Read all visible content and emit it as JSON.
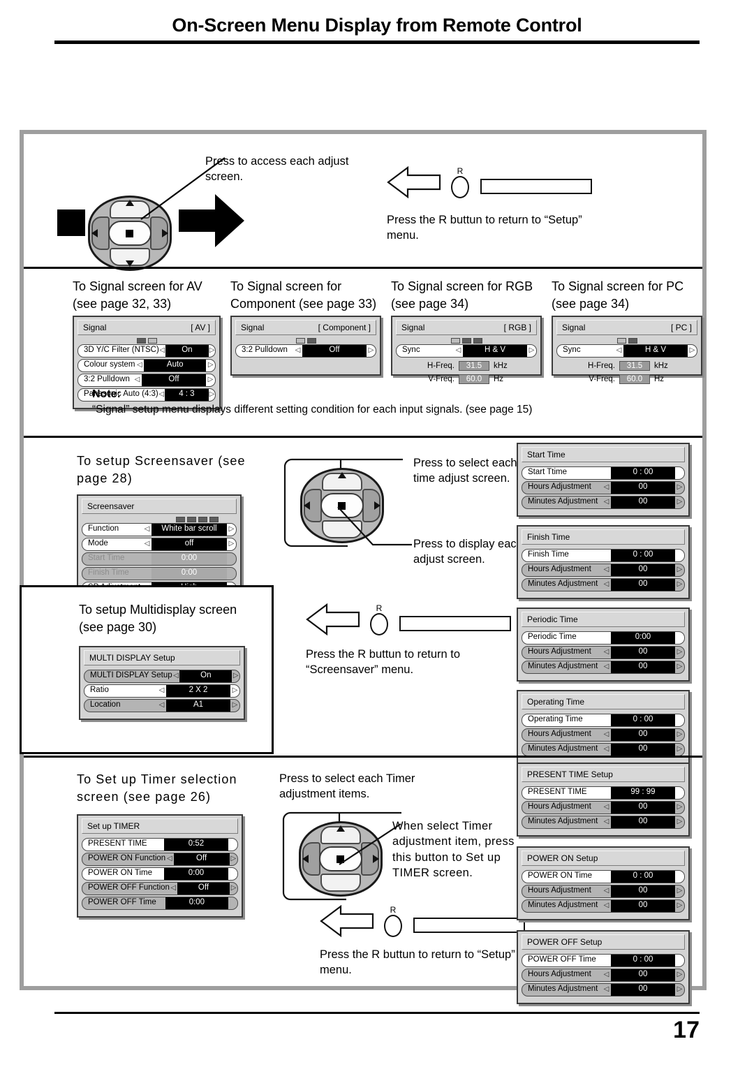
{
  "header": {
    "title": "On-Screen Menu Display from Remote Control"
  },
  "footer": {
    "page_number": "17"
  },
  "section_top": {
    "callout_access": "Press to access each adjust screen.",
    "r_label": "R",
    "return_text": "Press the R buttun to return to “Setup” menu."
  },
  "signal_section": {
    "columns": [
      {
        "heading": "To Signal screen for AV (see page 32, 33)",
        "panel": {
          "title_left": "Signal",
          "title_right": "[ AV ]",
          "dots": [
            true,
            false
          ],
          "rows": [
            {
              "label": "3D Y/C Filter  (NTSC)",
              "value": "On",
              "arrows": true,
              "grey": false
            },
            {
              "label": "Colour  system",
              "value": "Auto",
              "arrows": true,
              "grey": false
            },
            {
              "label": "3:2 Pulldown",
              "value": "Off",
              "arrows": true,
              "grey": false
            },
            {
              "label": "Panasonic  Auto  (4:3)",
              "value": "4 : 3",
              "arrows": true,
              "grey": false
            }
          ]
        }
      },
      {
        "heading": "To Signal screen for Component (see page 33)",
        "panel": {
          "title_left": "Signal",
          "title_right": "[ Component ]",
          "dots": [
            false,
            true
          ],
          "rows": [
            {
              "label": "3:2 Pulldown",
              "value": "Off",
              "arrows": true,
              "grey": false
            }
          ]
        }
      },
      {
        "heading": "To Signal screen for RGB (see page 34)",
        "panel": {
          "title_left": "Signal",
          "title_right": "[ RGB ]",
          "dots": [
            false,
            true,
            true
          ],
          "rows": [
            {
              "label": "Sync",
              "value": "H & V",
              "arrows": true,
              "grey": false
            }
          ],
          "freq": [
            {
              "name": "H-Freq.",
              "value": "31.5",
              "unit": "kHz"
            },
            {
              "name": "V-Freq.",
              "value": "60.0",
              "unit": "Hz"
            }
          ]
        }
      },
      {
        "heading": "To Signal screen for PC (see page 34)",
        "panel": {
          "title_left": "Signal",
          "title_right": "[ PC ]",
          "dots": [
            false,
            true
          ],
          "rows": [
            {
              "label": "Sync",
              "value": "H & V",
              "arrows": true,
              "grey": false
            }
          ],
          "freq": [
            {
              "name": "H-Freq.",
              "value": "31.5",
              "unit": "kHz"
            },
            {
              "name": "V-Freq.",
              "value": "60.0",
              "unit": "Hz"
            }
          ]
        }
      }
    ],
    "note_label": "Note:",
    "note_text": "“Signal” setup menu displays different setting condition for each input signals. (see page 15)"
  },
  "screensaver_section": {
    "heading": "To setup Screensaver (see page 28)",
    "panel": {
      "title_left": "Screensaver",
      "title_right": "",
      "dots": [
        true,
        true,
        true,
        true
      ],
      "rows": [
        {
          "label": "Function",
          "value": "White bar scroll",
          "arrows": true,
          "grey": false,
          "wide": true
        },
        {
          "label": "Mode",
          "value": "off",
          "arrows": true,
          "grey": false,
          "wide": true
        },
        {
          "label": "Start Time",
          "value": "0:00",
          "arrows": false,
          "grey": true,
          "dim": true,
          "wide": true
        },
        {
          "label": "Finish Time",
          "value": "0:00",
          "arrows": false,
          "grey": true,
          "dim": true,
          "wide": true
        },
        {
          "label": "SP Adjustment",
          "value": "High",
          "arrows": true,
          "grey": false,
          "wide": true
        }
      ]
    },
    "callout_select": "Press to select each time adjust screen.",
    "callout_display": "Press to display each adjust screen.",
    "time_panels": [
      {
        "title_left": "Start Time",
        "rows": [
          {
            "label": "Start Ttime",
            "value": "0 : 00",
            "arrows": false,
            "grey": false
          },
          {
            "label": "Hours Adjustment",
            "value": "00",
            "arrows": true,
            "grey": true
          },
          {
            "label": "Minutes Adjustment",
            "value": "00",
            "arrows": true,
            "grey": true
          }
        ]
      },
      {
        "title_left": "Finish Time",
        "rows": [
          {
            "label": "Finish Time",
            "value": "0 : 00",
            "arrows": false,
            "grey": false
          },
          {
            "label": "Hours Adjustment",
            "value": "00",
            "arrows": true,
            "grey": true
          },
          {
            "label": "Minutes Adjustment",
            "value": "00",
            "arrows": true,
            "grey": true
          }
        ]
      },
      {
        "title_left": "Periodic Time",
        "rows": [
          {
            "label": "Periodic Time",
            "value": "0:00",
            "arrows": false,
            "grey": false
          },
          {
            "label": "Hours Adjustment",
            "value": "00",
            "arrows": true,
            "grey": true
          },
          {
            "label": "Minutes Adjustment",
            "value": "00",
            "arrows": true,
            "grey": true
          }
        ]
      },
      {
        "title_left": "Operating Time",
        "rows": [
          {
            "label": "Operating Time",
            "value": "0 : 00",
            "arrows": false,
            "grey": false
          },
          {
            "label": "Hours Adjustment",
            "value": "00",
            "arrows": true,
            "grey": true
          },
          {
            "label": "Minutes Adjustment",
            "value": "00",
            "arrows": true,
            "grey": true
          }
        ]
      }
    ]
  },
  "multidisplay_section": {
    "heading": "To setup Multidisplay screen (see page 30)",
    "panel": {
      "title_left": "MULTI DISPLAY Setup",
      "title_right": "",
      "rows": [
        {
          "label": "MULTI DISPLAY Setup",
          "value": "On",
          "arrows": true,
          "grey": true
        },
        {
          "label": "Ratio",
          "value": "2 X 2",
          "arrows": true,
          "grey": false
        },
        {
          "label": "Location",
          "value": "A1",
          "arrows": true,
          "grey": true
        }
      ]
    },
    "r_label": "R",
    "return_text": "Press the R buttun to return to “Screensaver” menu."
  },
  "timer_section": {
    "heading": "To Set up Timer selection screen (see page 26)",
    "panel": {
      "title_left": "Set up TIMER",
      "title_right": "",
      "rows": [
        {
          "label": "PRESENT TIME",
          "value": "0:52",
          "arrows": false,
          "grey": false
        },
        {
          "label": "POWER ON Function",
          "value": "Off",
          "arrows": true,
          "grey": true
        },
        {
          "label": "POWER ON Time",
          "value": "0:00",
          "arrows": false,
          "grey": false
        },
        {
          "label": "POWER OFF Function",
          "value": "Off",
          "arrows": true,
          "grey": true
        },
        {
          "label": "POWER OFF Time",
          "value": "0:00",
          "arrows": false,
          "grey": true
        }
      ]
    },
    "callout_select": "Press to select each Timer adjustment items.",
    "callout_press": "When select Timer adjustment item, press this button to Set up TIMER screen.",
    "r_label": "R",
    "return_text": "Press the R buttun to return to “Setup” menu.",
    "setup_panels": [
      {
        "title_left": "PRESENT TIME Setup",
        "rows": [
          {
            "label": "PRESENT TIME",
            "value": "99 : 99",
            "arrows": false,
            "grey": false
          },
          {
            "label": "Hours Adjustment",
            "value": "00",
            "arrows": true,
            "grey": true
          },
          {
            "label": "Minutes Adjustment",
            "value": "00",
            "arrows": true,
            "grey": true
          }
        ]
      },
      {
        "title_left": "POWER ON Setup",
        "rows": [
          {
            "label": "POWER ON Time",
            "value": "0 : 00",
            "arrows": false,
            "grey": false
          },
          {
            "label": "Hours Adjustment",
            "value": "00",
            "arrows": true,
            "grey": true
          },
          {
            "label": "Minutes Adjustment",
            "value": "00",
            "arrows": true,
            "grey": true
          }
        ]
      },
      {
        "title_left": "POWER OFF Setup",
        "rows": [
          {
            "label": "POWER OFF Time",
            "value": "0 : 00",
            "arrows": false,
            "grey": false
          },
          {
            "label": "Hours Adjustment",
            "value": "00",
            "arrows": true,
            "grey": true
          },
          {
            "label": "Minutes Adjustment",
            "value": "00",
            "arrows": true,
            "grey": true
          }
        ]
      }
    ]
  },
  "icons": {
    "arrow_left": "◁",
    "arrow_right": "▷"
  }
}
